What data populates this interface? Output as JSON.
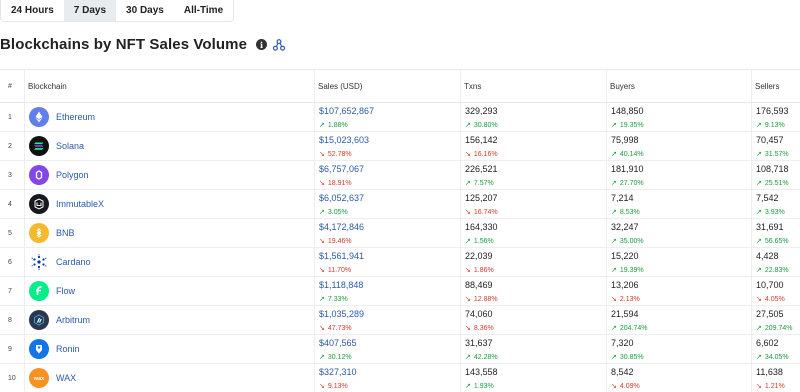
{
  "tabs": [
    {
      "label": "24 Hours",
      "active": false
    },
    {
      "label": "7 Days",
      "active": true
    },
    {
      "label": "30 Days",
      "active": false
    },
    {
      "label": "All-Time",
      "active": false
    }
  ],
  "title": "Blockchains by NFT Sales Volume",
  "info_glyph": "i",
  "headers": {
    "num": "#",
    "chain": "Blockchain",
    "sales": "Sales (USD)",
    "txns": "Txns",
    "buyers": "Buyers",
    "sellers": "Sellers"
  },
  "arrows": {
    "up": "↗",
    "down": "↘"
  },
  "rows": [
    {
      "num": "1",
      "chain": "Ethereum",
      "logo": "ethereum-logo-icon",
      "logo_color": "#627eea",
      "sales": "$107,652,867",
      "sales_chg": "1.88%",
      "sales_dir": "up",
      "txns": "329,293",
      "txns_chg": "30.80%",
      "txns_dir": "up",
      "buyers": "148,850",
      "buyers_chg": "19.35%",
      "buyers_dir": "up",
      "sellers": "176,593",
      "sellers_chg": "9.13%",
      "sellers_dir": "up"
    },
    {
      "num": "2",
      "chain": "Solana",
      "logo": "solana-logo-icon",
      "logo_color": "#111111",
      "sales": "$15,023,603",
      "sales_chg": "52.78%",
      "sales_dir": "down",
      "txns": "156,142",
      "txns_chg": "16.16%",
      "txns_dir": "down",
      "buyers": "75,998",
      "buyers_chg": "40.14%",
      "buyers_dir": "up",
      "sellers": "70,457",
      "sellers_chg": "31.57%",
      "sellers_dir": "up"
    },
    {
      "num": "3",
      "chain": "Polygon",
      "logo": "polygon-logo-icon",
      "logo_color": "#8247e5",
      "sales": "$6,757,067",
      "sales_chg": "18.91%",
      "sales_dir": "down",
      "txns": "226,521",
      "txns_chg": "7.57%",
      "txns_dir": "up",
      "buyers": "181,910",
      "buyers_chg": "27.70%",
      "buyers_dir": "up",
      "sellers": "108,718",
      "sellers_chg": "25.51%",
      "sellers_dir": "up"
    },
    {
      "num": "4",
      "chain": "ImmutableX",
      "logo": "immutablex-logo-icon",
      "logo_color": "#17191e",
      "sales": "$6,052,637",
      "sales_chg": "3.05%",
      "sales_dir": "up",
      "txns": "125,207",
      "txns_chg": "16.74%",
      "txns_dir": "down",
      "buyers": "7,214",
      "buyers_chg": "8.53%",
      "buyers_dir": "up",
      "sellers": "7,542",
      "sellers_chg": "3.93%",
      "sellers_dir": "up"
    },
    {
      "num": "5",
      "chain": "BNB",
      "logo": "bnb-logo-icon",
      "logo_color": "#f3ba2f",
      "sales": "$4,172,846",
      "sales_chg": "19.46%",
      "sales_dir": "down",
      "txns": "164,330",
      "txns_chg": "1.56%",
      "txns_dir": "up",
      "buyers": "32,247",
      "buyers_chg": "35.00%",
      "buyers_dir": "up",
      "sellers": "31,691",
      "sellers_chg": "56.65%",
      "sellers_dir": "up"
    },
    {
      "num": "6",
      "chain": "Cardano",
      "logo": "cardano-logo-icon",
      "logo_color": "#ffffff",
      "sales": "$1,561,941",
      "sales_chg": "11.70%",
      "sales_dir": "down",
      "txns": "22,039",
      "txns_chg": "1.86%",
      "txns_dir": "down",
      "buyers": "15,220",
      "buyers_chg": "19.39%",
      "buyers_dir": "up",
      "sellers": "4,428",
      "sellers_chg": "22.83%",
      "sellers_dir": "up"
    },
    {
      "num": "7",
      "chain": "Flow",
      "logo": "flow-logo-icon",
      "logo_color": "#00ef8b",
      "sales": "$1,118,848",
      "sales_chg": "7.33%",
      "sales_dir": "up",
      "txns": "88,469",
      "txns_chg": "12.88%",
      "txns_dir": "down",
      "buyers": "13,206",
      "buyers_chg": "2.13%",
      "buyers_dir": "down",
      "sellers": "10,700",
      "sellers_chg": "4.05%",
      "sellers_dir": "down"
    },
    {
      "num": "8",
      "chain": "Arbitrum",
      "logo": "arbitrum-logo-icon",
      "logo_color": "#2d374b",
      "sales": "$1,035,289",
      "sales_chg": "47.73%",
      "sales_dir": "down",
      "txns": "74,060",
      "txns_chg": "8.36%",
      "txns_dir": "down",
      "buyers": "21,594",
      "buyers_chg": "204.74%",
      "buyers_dir": "up",
      "sellers": "27,505",
      "sellers_chg": "209.74%",
      "sellers_dir": "up"
    },
    {
      "num": "9",
      "chain": "Ronin",
      "logo": "ronin-logo-icon",
      "logo_color": "#1273ea",
      "sales": "$407,565",
      "sales_chg": "30.12%",
      "sales_dir": "up",
      "txns": "31,637",
      "txns_chg": "42.28%",
      "txns_dir": "up",
      "buyers": "7,320",
      "buyers_chg": "30.85%",
      "buyers_dir": "up",
      "sellers": "6,602",
      "sellers_chg": "34.05%",
      "sellers_dir": "up"
    },
    {
      "num": "10",
      "chain": "WAX",
      "logo": "wax-logo-icon",
      "logo_color": "#f89022",
      "sales": "$327,310",
      "sales_chg": "9.13%",
      "sales_dir": "down",
      "txns": "143,558",
      "txns_chg": "1.93%",
      "txns_dir": "up",
      "buyers": "8,542",
      "buyers_chg": "4.09%",
      "buyers_dir": "down",
      "sellers": "11,638",
      "sellers_chg": "1.21%",
      "sellers_dir": "down"
    }
  ]
}
